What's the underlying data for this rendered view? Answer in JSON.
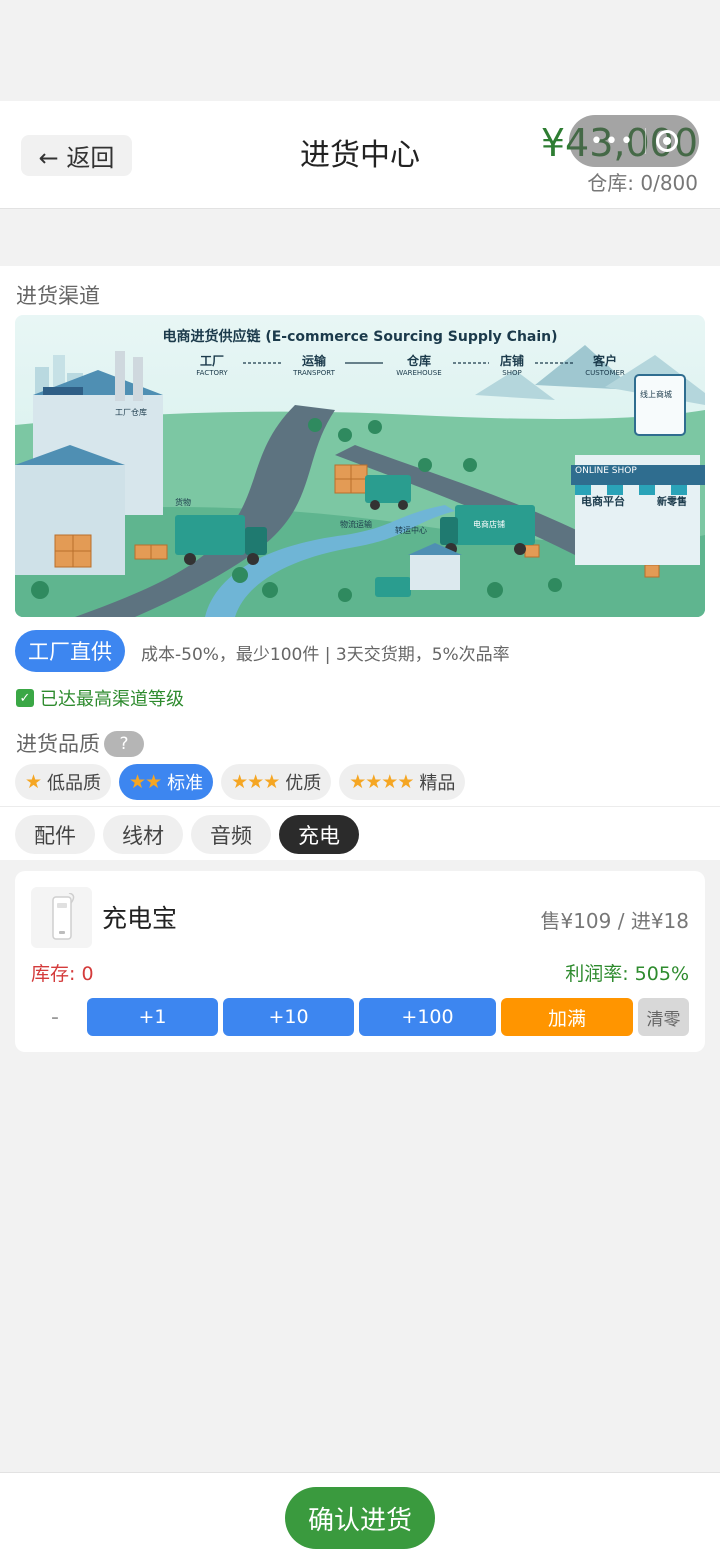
{
  "header": {
    "back_label": "← 返回",
    "title": "进货中心",
    "money": "¥43,000",
    "warehouse": "仓库: 0/800"
  },
  "channel": {
    "section_label": "进货渠道",
    "banner": {
      "title": "电商进货供应链 (E-commerce Sourcing Supply Chain)",
      "steps": [
        {
          "cn": "工厂",
          "en": "FACTORY"
        },
        {
          "cn": "运输",
          "en": "TRANSPORT"
        },
        {
          "cn": "仓库",
          "en": "WAREHOUSE"
        },
        {
          "cn": "店铺",
          "en": "SHOP"
        },
        {
          "cn": "客户",
          "en": "CUSTOMER"
        }
      ],
      "labels": {
        "factory": "工厂仓库",
        "goods": "货物",
        "logistics": "物流运输",
        "shop": "电商平台",
        "new_retail": "新零售",
        "online_shop": "ONLINE SHOP",
        "online_mall": "线上商城",
        "truck": "电商店铺",
        "hub": "转运中心"
      }
    },
    "current_tag": "工厂直供",
    "description": "成本-50%，最少100件 | 3天交货期，5%次品率",
    "level_status": "已达最高渠道等级"
  },
  "quality": {
    "section_label": "进货品质",
    "help_label": "?",
    "options": [
      {
        "stars": "★",
        "label": "低品质"
      },
      {
        "stars": "★★",
        "label": "标准"
      },
      {
        "stars": "★★★",
        "label": "优质"
      },
      {
        "stars": "★★★★",
        "label": "精品"
      }
    ],
    "selected": 1
  },
  "categories": {
    "items": [
      "配件",
      "线材",
      "音频",
      "充电"
    ],
    "selected": 3
  },
  "product": {
    "name": "充电宝",
    "price": "售¥109 / 进¥18",
    "stock": "库存: 0",
    "profit": "利润率: 505%",
    "minus_label": "-",
    "buttons": [
      "+1",
      "+10",
      "+100"
    ],
    "fill_label": "加满",
    "clear_label": "清零"
  },
  "footer": {
    "confirm_label": "确认进货"
  },
  "colors": {
    "accent_blue": "#3d86f0",
    "money_green": "#2e7d32",
    "confirm_green": "#3a9a3e",
    "fill_orange": "#ff9500",
    "stock_red": "#d43b3b"
  }
}
